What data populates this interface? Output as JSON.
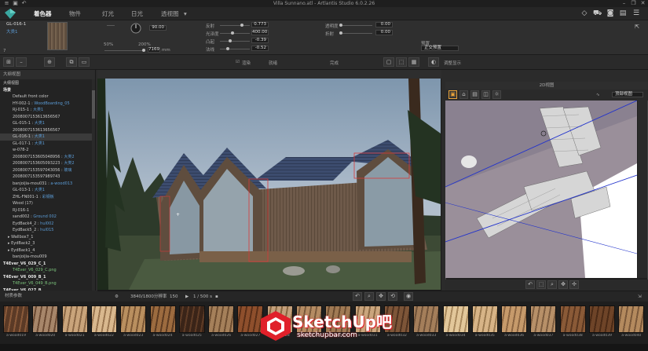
{
  "app": {
    "title": "Villa Sunnano.atl - Artlantis Studio 6.0.2.26",
    "minimize": "–",
    "maximize": "❐",
    "close": "✕"
  },
  "menu": {
    "tabs": [
      {
        "label": "着色器",
        "active": true
      },
      {
        "label": "物件",
        "active": false
      },
      {
        "label": "灯光",
        "active": false
      },
      {
        "label": "日光",
        "active": false
      },
      {
        "label": "透视图",
        "active": false
      }
    ],
    "dropdown_arrow": "▾"
  },
  "material": {
    "name": "GL-016-1",
    "sub": "大类1",
    "angle": "90.00",
    "size_label_a": "50%",
    "size_label_b": "200%",
    "size_value": "7169",
    "size_unit": "mm",
    "count": "7"
  },
  "params": [
    {
      "label": "反射",
      "value": "0.773",
      "level": 0.77
    },
    {
      "label": "光泽度",
      "value": "400.00",
      "level": 0.4
    },
    {
      "label": "凸起",
      "value": "-0.39",
      "level": 0.31
    },
    {
      "label": "法线",
      "value": "-0.52",
      "level": 0.24
    }
  ],
  "params_right": [
    {
      "label": "透明度",
      "value": "0.00",
      "level": 0.0
    },
    {
      "label": "折射",
      "value": "0.00",
      "level": 0.0
    }
  ],
  "preset": {
    "label": "预置",
    "value": "正交预置"
  },
  "toolbar": {
    "icon_render": "渲染",
    "icon_ready": "就绪",
    "icon_display": "完成",
    "ref": "调整显示"
  },
  "left_panel": {
    "header": "大纲视图",
    "items": [
      {
        "text": "大纲视图",
        "style": "normal",
        "indent": 0
      },
      {
        "text": "场景",
        "style": "bold",
        "indent": 0
      },
      {
        "text": "Default front color",
        "style": "normal",
        "indent": 2
      },
      {
        "text": "HY-002-1 : WoodBoarding_05",
        "style": "normal",
        "indent": 2,
        "link": true
      },
      {
        "text": "RJ-015-1 : 大类1",
        "style": "normal",
        "indent": 2,
        "link": true
      },
      {
        "text": "2008007153613656567",
        "style": "normal",
        "indent": 2
      },
      {
        "text": "GL-015-1 : 大类1",
        "style": "normal",
        "indent": 2,
        "link": true
      },
      {
        "text": "2008007153613656567",
        "style": "normal",
        "indent": 2
      },
      {
        "text": "GL-016-1 : 大类1",
        "style": "sel",
        "indent": 2,
        "link": true
      },
      {
        "text": "GL-017-1 : 大类1",
        "style": "normal",
        "indent": 2,
        "link": true
      },
      {
        "text": "w-078-2",
        "style": "normal",
        "indent": 2
      },
      {
        "text": "2008007153605048956 : 大类2",
        "style": "normal",
        "indent": 2,
        "link": true
      },
      {
        "text": "2008007153605093223 : 大类2",
        "style": "normal",
        "indent": 2,
        "link": true
      },
      {
        "text": "2008007153597043056 : 玻璃",
        "style": "normal",
        "indent": 2,
        "link": true
      },
      {
        "text": "2008007153597989743",
        "style": "normal",
        "indent": 2
      },
      {
        "text": "banjoijia-mou031 : a-wood013",
        "style": "normal",
        "indent": 2,
        "link": true
      },
      {
        "text": "GL-013-1 : 大类1",
        "style": "normal",
        "indent": 2,
        "link": true
      },
      {
        "text": "ZHL-FN001-1 : 彩钢板",
        "style": "normal",
        "indent": 2,
        "link": true
      },
      {
        "text": "Wood (17)",
        "style": "normal",
        "indent": 2
      },
      {
        "text": "RJ-016-1",
        "style": "normal",
        "indent": 2
      },
      {
        "text": "sand002 : Ground 002",
        "style": "normal",
        "indent": 2,
        "link": true
      },
      {
        "text": "EydBack4_2 : hul002",
        "style": "normal",
        "indent": 2,
        "link": true
      },
      {
        "text": "EydBack5_2 : hul015",
        "style": "normal",
        "indent": 2,
        "link": true
      },
      {
        "text": "Wallbox7_1",
        "style": "normal",
        "indent": 1
      },
      {
        "text": "EydBack2_3",
        "style": "normal",
        "indent": 1
      },
      {
        "text": "EydBack1_4",
        "style": "normal",
        "indent": 1
      },
      {
        "text": "banjoijia-mou009",
        "style": "normal",
        "indent": 2
      },
      {
        "text": "T4Ever_V6_029_C_1",
        "style": "bold",
        "indent": 0
      },
      {
        "text": "T4Ever_V6_029_C.png",
        "style": "green",
        "indent": 2
      },
      {
        "text": "T4Ever_V6_009_B_1",
        "style": "bold",
        "indent": 0
      },
      {
        "text": "T4Ever_V6_049_B.png",
        "style": "green",
        "indent": 2
      },
      {
        "text": "T4Ever_V6_027_B",
        "style": "bold",
        "indent": 0
      }
    ],
    "footer": "材质参数"
  },
  "viewport": {
    "resolution": "3840/1800分辨率",
    "quality": "150",
    "page": "1 / 500 s"
  },
  "twod": {
    "title": "2D视图",
    "view": "顶部视图"
  },
  "materials": [
    {
      "name": "a-wood019",
      "c1": "#5b3a26",
      "c2": "#8a5a3a"
    },
    {
      "name": "a-wood020",
      "c1": "#a7866a",
      "c2": "#6b4a33"
    },
    {
      "name": "a-wood021",
      "c1": "#c9a47b",
      "c2": "#8b6846"
    },
    {
      "name": "a-wood022",
      "c1": "#d9b88e",
      "c2": "#9a7650"
    },
    {
      "name": "a-wood023",
      "c1": "#b98f5f",
      "c2": "#7a5634"
    },
    {
      "name": "a-wood024",
      "c1": "#9c6b3f",
      "c2": "#5d3b22"
    },
    {
      "name": "a-wood025",
      "c1": "#3a2418",
      "c2": "#5f3c26"
    },
    {
      "name": "a-wood026",
      "c1": "#a5805a",
      "c2": "#6e4e31"
    },
    {
      "name": "a-wood027",
      "c1": "#8e4f2c",
      "c2": "#5a2f18"
    },
    {
      "name": "a-wood028",
      "c1": "#c3a07c",
      "c2": "#87663f"
    },
    {
      "name": "a-wood029",
      "c1": "#b58c63",
      "c2": "#7a5a3c"
    },
    {
      "name": "a-wood030",
      "c1": "#a07a54",
      "c2": "#6b4c30"
    },
    {
      "name": "a-wood031",
      "c1": "#caa57d",
      "c2": "#8d6b46"
    },
    {
      "name": "a-wood032",
      "c1": "#7d5538",
      "c2": "#4f3220"
    },
    {
      "name": "a-wood033",
      "c1": "#a47e5a",
      "c2": "#70533a"
    },
    {
      "name": "a-wood034",
      "c1": "#e2c79a",
      "c2": "#a98a5e"
    },
    {
      "name": "a-wood035",
      "c1": "#d7b487",
      "c2": "#9b7a50"
    },
    {
      "name": "a-wood036",
      "c1": "#c69a6b",
      "c2": "#8b6542"
    },
    {
      "name": "a-wood037",
      "c1": "#b79068",
      "c2": "#7c5c3f"
    },
    {
      "name": "a-wood038",
      "c1": "#8a5a37",
      "c2": "#5a3720"
    },
    {
      "name": "a-wood039",
      "c1": "#6e4428",
      "c2": "#4a2a16"
    },
    {
      "name": "a-wood040",
      "c1": "#b48a5e",
      "c2": "#7a583a"
    }
  ],
  "watermark": {
    "brand": "SketchUp吧",
    "url": "sketchupbar.com"
  },
  "colors": {
    "accent_orange": "#e8a23a",
    "link_blue": "#5b9bd5",
    "selection_red": "#d83a3a",
    "watermark_red": "#e0202a"
  }
}
